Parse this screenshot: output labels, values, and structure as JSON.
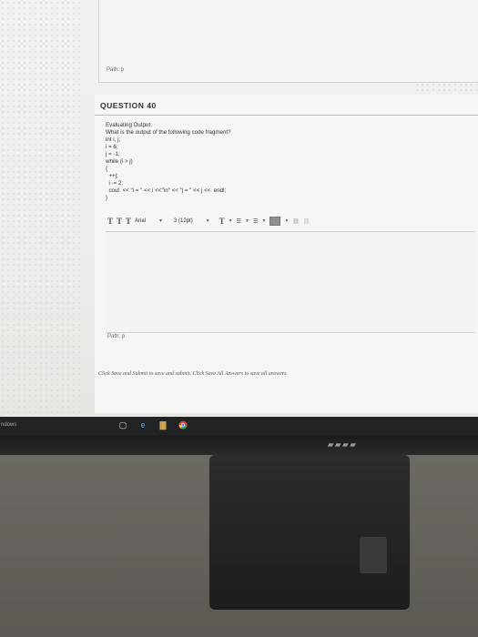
{
  "screen": {
    "upper_path": "Path: p",
    "question": {
      "title": "QUESTION 40",
      "heading": "Evaluating Output.",
      "prompt": "What is the output of the following code fragment?",
      "code": [
        "int i, j;",
        "i = 6;",
        "j = -1;",
        "while (i > j)",
        "{",
        "  ++j;",
        "  i -= 2;",
        "  cout  << \"i = \" << i <<\"\\n\" << \"j = \" << j <<  endl;",
        "}"
      ]
    },
    "toolbar": {
      "font": "Arial",
      "size": "3 (12pt)"
    },
    "editor_path": "Path: p",
    "footer": "Click Save and Submit to save and submit. Click Save All Answers to save all answers."
  },
  "taskbar": {
    "label": "ndows"
  },
  "colors": {
    "screen_bg": "#f1f1ef",
    "taskbar_bg": "#222325",
    "desk": "#6d6a64"
  }
}
